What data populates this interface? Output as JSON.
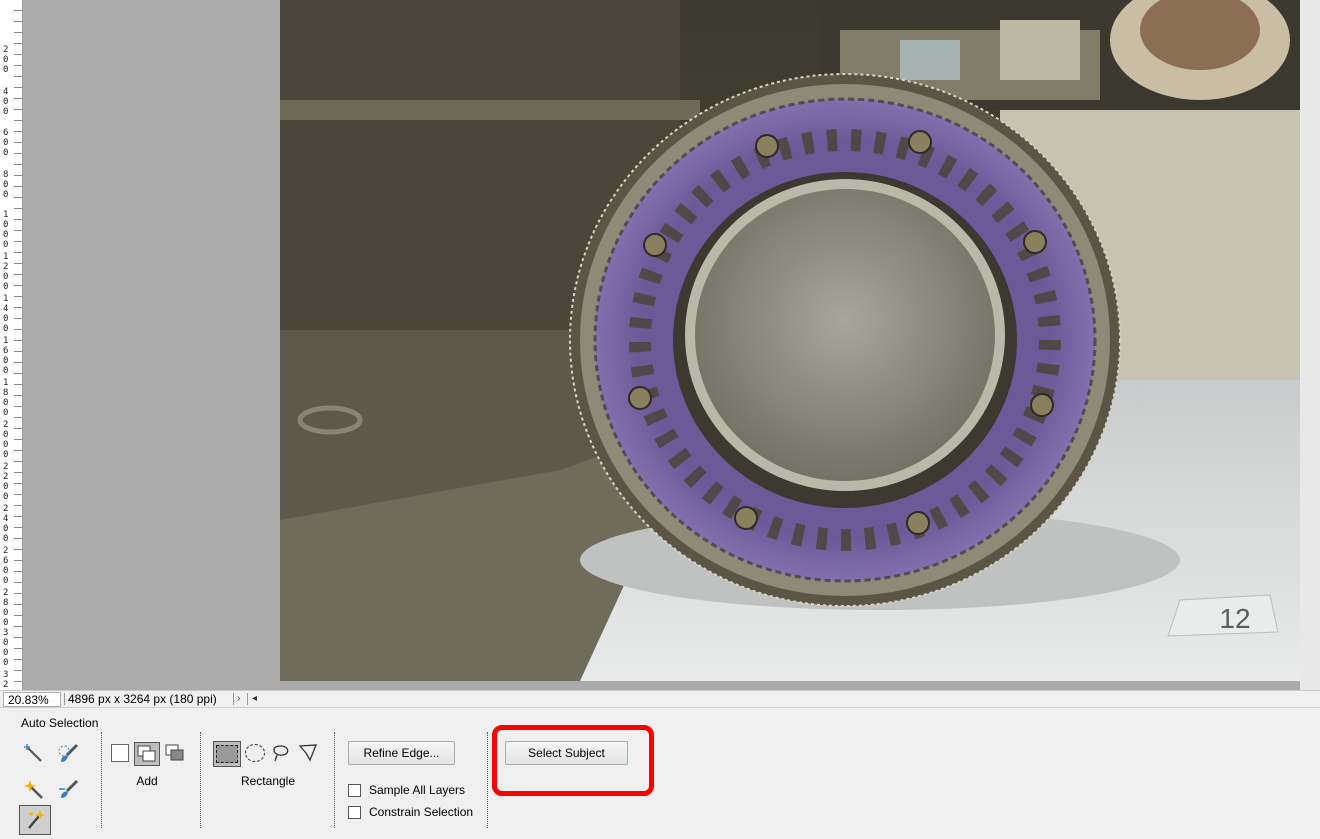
{
  "ruler": {
    "labels": [
      "2\n0\n0",
      "4\n0\n0",
      "6\n0\n0",
      "8\n0\n0",
      "1\n0\n0\n0",
      "1\n2\n0\n0",
      "1\n4\n0\n0",
      "1\n6\n0\n0",
      "1\n8\n0\n0",
      "2\n0\n0\n0",
      "2\n2\n0\n0",
      "2\n4\n0\n0",
      "2\n6\n0\n0",
      "2\n8\n0\n0",
      "3\n0\n0\n0",
      "3\n2"
    ]
  },
  "canvas": {
    "image_label_number": "12"
  },
  "status": {
    "zoom": "20.83%",
    "doc_size": "4896 px x 3264 px (180 ppi)",
    "arrow_right": "›",
    "arrow_left": "◂"
  },
  "options": {
    "title": "Auto Selection",
    "tools": [
      {
        "icon": "magic-wand-icon"
      },
      {
        "icon": "quick-selection-brush-icon"
      },
      {
        "icon": "sparkle-wand-icon"
      },
      {
        "icon": "refine-brush-icon"
      },
      {
        "icon": "auto-selection-wand-icon",
        "active": true
      }
    ],
    "mode_label": "Add",
    "shape_label": "Rectangle",
    "refine_edge_label": "Refine Edge...",
    "sample_all_layers_label": "Sample All Layers",
    "constrain_selection_label": "Constrain Selection",
    "select_subject_label": "Select Subject"
  },
  "colors": {
    "highlight": "#ff0000",
    "workspace": "#ababab",
    "frame_purple": "#7d6aa8",
    "frame_silver": "#9c9a8c"
  }
}
